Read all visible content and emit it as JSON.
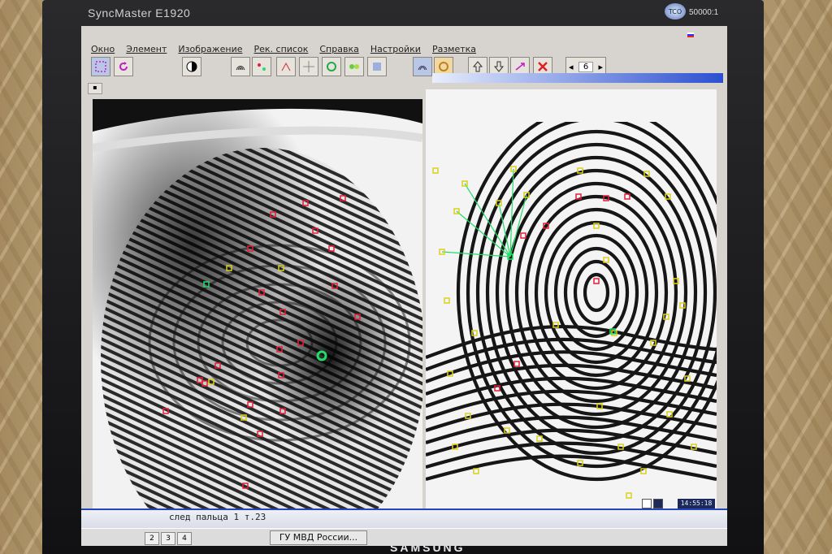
{
  "monitor": {
    "model": "SyncMaster E1920",
    "contrast": "50000:1",
    "logo_badge": "TCO",
    "maker": "SAMSUNG"
  },
  "menu": {
    "items": [
      "Окно",
      "Элемент",
      "Изображение",
      "Рек. список",
      "Справка",
      "Настройки",
      "Разметка"
    ]
  },
  "toolbar": {
    "icons": [
      "select-region-icon",
      "rotate-icon",
      "contrast-icon",
      "fingerprint-filter-icon",
      "minutiae-red-icon",
      "minutiae-link-icon",
      "crosshair-icon",
      "target-icon",
      "pair-icon",
      "layer-icon",
      "fingerprint-view-icon",
      "overlay-icon",
      "arrow-up-icon",
      "arrow-down-icon",
      "swap-icon",
      "close-icon"
    ],
    "page_number": "6"
  },
  "status": {
    "text": "след пальца 1 т.23",
    "clock": "14:55:18"
  },
  "taskbar": {
    "task": "ГУ МВД России...",
    "tabs": [
      "2",
      "3",
      "4"
    ]
  },
  "colors": {
    "marker_red": "#e0203a",
    "marker_yellow": "#d8d020",
    "marker_green": "#22dd66",
    "title_blue": "#2b4fd0"
  }
}
